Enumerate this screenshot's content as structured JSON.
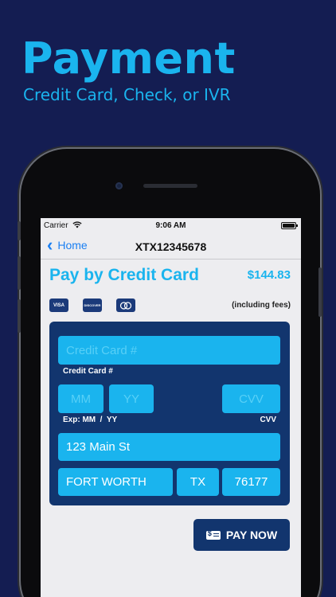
{
  "promo": {
    "headline": "Payment",
    "subheadline": "Credit Card, Check, or IVR"
  },
  "statusbar": {
    "carrier": "Carrier",
    "time": "9:06 AM"
  },
  "navbar": {
    "back_label": "Home",
    "title": "XTX12345678"
  },
  "payment": {
    "title": "Pay by Credit Card",
    "amount": "$144.83",
    "fees_note": "(including fees)",
    "card_logos": [
      "VISA",
      "DISCOVER",
      "MC"
    ]
  },
  "form": {
    "card_number": {
      "placeholder": "Credit Card #",
      "label": "Credit Card #"
    },
    "exp_month": {
      "placeholder": "MM"
    },
    "exp_year": {
      "placeholder": "YY"
    },
    "exp_label": "Exp: MM  /  YY",
    "cvv": {
      "placeholder": "CVV",
      "label": "CVV"
    },
    "street": {
      "value": "123 Main St"
    },
    "city": {
      "value": "FORT WORTH"
    },
    "state": {
      "value": "TX"
    },
    "zip": {
      "value": "76177"
    }
  },
  "actions": {
    "pay_now_label": "PAY NOW"
  },
  "colors": {
    "background": "#141d52",
    "accent": "#1ab4ee",
    "card": "#12356e"
  }
}
